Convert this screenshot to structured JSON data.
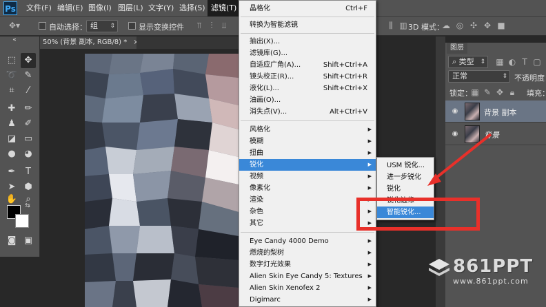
{
  "app": {
    "logo": "Ps"
  },
  "menubar": {
    "items": [
      "文件(F)",
      "编辑(E)",
      "图像(I)",
      "图层(L)",
      "文字(Y)",
      "选择(S)",
      "滤镜(T)"
    ]
  },
  "options": {
    "auto_select_label": "自动选择：",
    "auto_select_value": "组",
    "show_transform_label": "显示变换控件",
    "mode_3d_label": "3D 模式："
  },
  "document": {
    "tab_title": "50% (背景 副本, RGB/8) *",
    "tab_close": "×"
  },
  "filter_menu": {
    "items": [
      {
        "label": "晶格化",
        "shortcut": "Ctrl+F"
      },
      {
        "label": "转换为智能滤镜",
        "shortcut": ""
      },
      {
        "label": "抽出(X)...",
        "shortcut": ""
      },
      {
        "label": "滤镜库(G)...",
        "shortcut": ""
      },
      {
        "label": "自适应广角(A)...",
        "shortcut": "Shift+Ctrl+A"
      },
      {
        "label": "镜头校正(R)...",
        "shortcut": "Shift+Ctrl+R"
      },
      {
        "label": "液化(L)...",
        "shortcut": "Shift+Ctrl+X"
      },
      {
        "label": "油画(O)...",
        "shortcut": ""
      },
      {
        "label": "消失点(V)...",
        "shortcut": "Alt+Ctrl+V"
      },
      {
        "label": "风格化",
        "shortcut": ""
      },
      {
        "label": "模糊",
        "shortcut": ""
      },
      {
        "label": "扭曲",
        "shortcut": ""
      },
      {
        "label": "锐化",
        "shortcut": ""
      },
      {
        "label": "视频",
        "shortcut": ""
      },
      {
        "label": "像素化",
        "shortcut": ""
      },
      {
        "label": "渲染",
        "shortcut": ""
      },
      {
        "label": "杂色",
        "shortcut": ""
      },
      {
        "label": "其它",
        "shortcut": ""
      },
      {
        "label": "Eye Candy 4000 Demo",
        "shortcut": ""
      },
      {
        "label": "燃烧的梨树",
        "shortcut": ""
      },
      {
        "label": "数字灯光效果",
        "shortcut": ""
      },
      {
        "label": "Alien Skin Eye Candy 5: Textures",
        "shortcut": ""
      },
      {
        "label": "Alien Skin Xenofex 2",
        "shortcut": ""
      },
      {
        "label": "Digimarc",
        "shortcut": ""
      }
    ],
    "submenu_arrow": "▶"
  },
  "sharpen_submenu": {
    "items": [
      "USM 锐化...",
      "进一步锐化",
      "锐化",
      "锐化边缘",
      "智能锐化..."
    ]
  },
  "layers_panel": {
    "tab": "图层",
    "filter_kind": "类型",
    "blend_mode": "正常",
    "opacity_label": "不透明度：",
    "lock_label": "锁定：",
    "fill_label": "填充：",
    "layers": [
      {
        "name": "背景 副本",
        "selected": true
      },
      {
        "name": "背景",
        "selected": false
      }
    ]
  },
  "watermark": {
    "brand": "861PPT",
    "url": "www.861ppt.com"
  },
  "colors": {
    "highlight": "#3a88d8",
    "annotation_red": "#e8302a",
    "menubar": "#535353"
  }
}
